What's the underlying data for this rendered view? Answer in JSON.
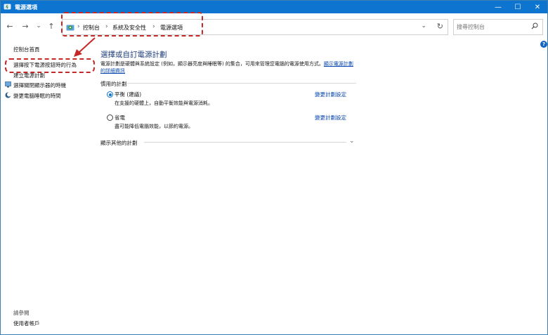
{
  "window": {
    "title": "電源選項",
    "controls": {
      "minimize": "—",
      "maximize": "☐",
      "close": "✕"
    }
  },
  "nav": {
    "back": "←",
    "forward": "→",
    "recent": "⌄",
    "up": "↑"
  },
  "address": {
    "separator": "›",
    "crumbs": [
      "控制台",
      "系統及安全性",
      "電源選項"
    ],
    "dropdown": "⌄",
    "refresh": "↻"
  },
  "search": {
    "placeholder": "搜尋控制台"
  },
  "sidebar": {
    "home": "控制台首頁",
    "items": [
      {
        "label": "選擇按下電源按鈕時的行為",
        "icon": ""
      },
      {
        "label": "建立電源計劃",
        "icon": ""
      },
      {
        "label": "選擇關閉顯示器的時機",
        "icon": "monitor-icon"
      },
      {
        "label": "變更電腦睡眠的時間",
        "icon": "moon-icon"
      }
    ],
    "see_also": "請參閱",
    "user_accounts": "使用者帳戶"
  },
  "main": {
    "heading": "選擇或自訂電源計劃",
    "description": "電源計劃是硬體與系統設定 (例如，顯示器亮度與睡眠等) 的集合，可用來管理您電腦的電源使用方式。",
    "description_link": "顯示電源計劃的詳細資訊",
    "preferred_label": "慣用的計劃",
    "plans": [
      {
        "name": "平衡 (建議)",
        "desc": "在支援的硬體上，自動平衡效能與電源消耗。",
        "selected": true,
        "change": "變更計劃設定"
      },
      {
        "name": "省電",
        "desc": "盡可能降低電腦效能，以節約電源。",
        "selected": false,
        "change": "變更計劃設定"
      }
    ],
    "more_plans": "顯示其他的計劃",
    "more_chevron": "⌄"
  },
  "help": "?",
  "colors": {
    "accent": "#0d74d0",
    "annotation": "#c62828",
    "link": "#0645ad",
    "heading": "#1e3c78"
  }
}
